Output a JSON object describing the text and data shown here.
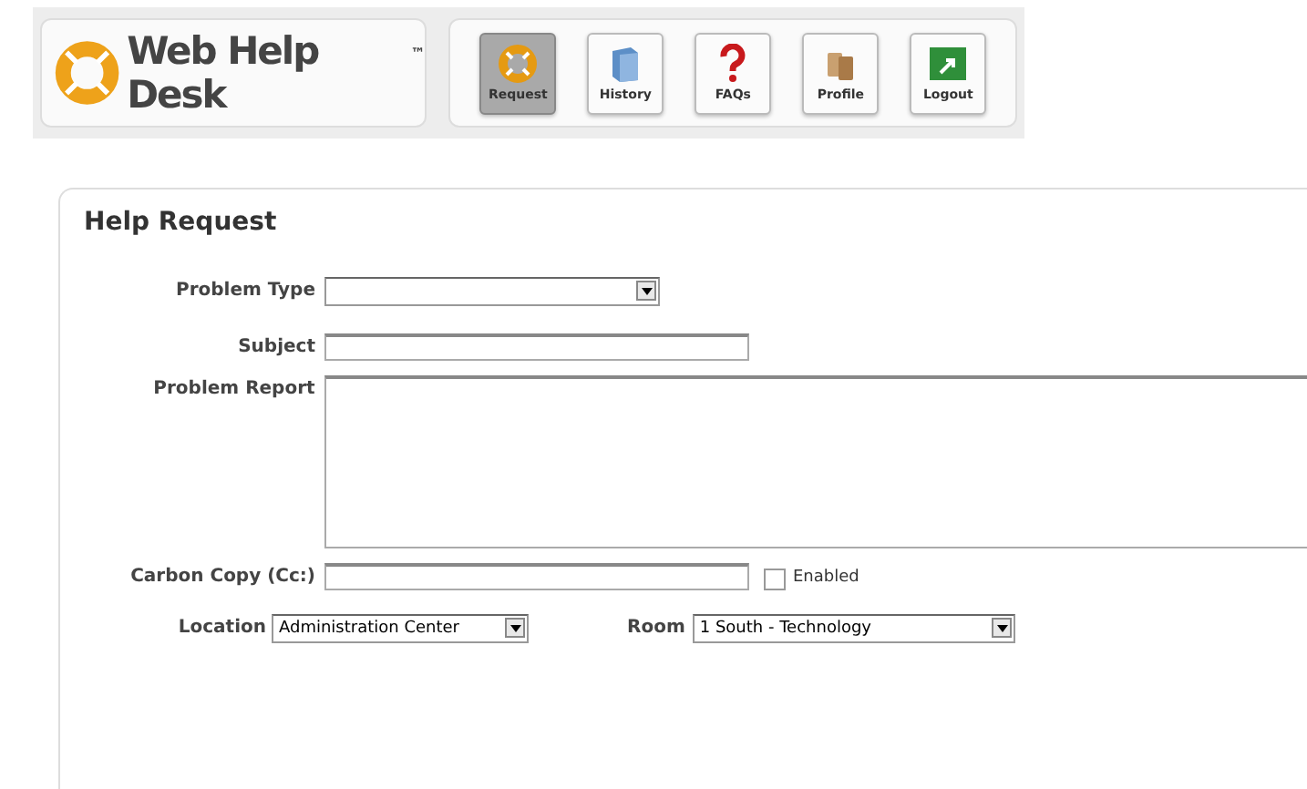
{
  "logo": {
    "text": "Web Help Desk",
    "mark": "™"
  },
  "nav": [
    {
      "label": "Request",
      "kind": "ring",
      "selected": true
    },
    {
      "label": "History",
      "kind": "book",
      "selected": false
    },
    {
      "label": "FAQs",
      "kind": "question",
      "selected": false
    },
    {
      "label": "Profile",
      "kind": "profile",
      "selected": false
    },
    {
      "label": "Logout",
      "kind": "exit",
      "selected": false
    }
  ],
  "form": {
    "title": "Help Request",
    "problem_type": {
      "label": "Problem Type"
    },
    "subject": {
      "label": "Subject"
    },
    "problem_report": {
      "label": "Problem Report"
    },
    "carbon_copy": {
      "label": "Carbon Copy (Cc:)",
      "enabled_label": "Enabled",
      "checked": false
    },
    "location": {
      "label": "Location",
      "value": "Administration Center"
    },
    "room": {
      "label": "Room",
      "value": "1 South - Technology"
    }
  }
}
